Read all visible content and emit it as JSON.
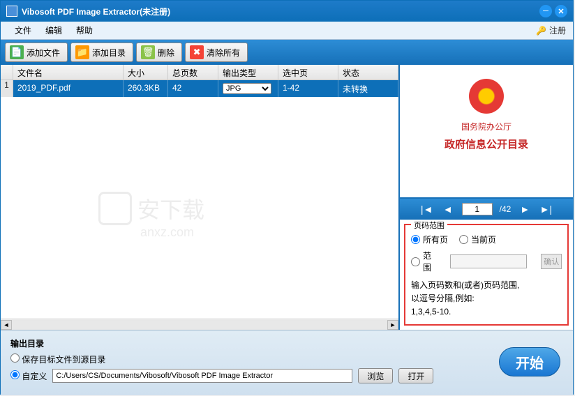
{
  "titlebar": {
    "title": "Vibosoft PDF Image Extractor(未注册)"
  },
  "menubar": {
    "file": "文件",
    "edit": "编辑",
    "help": "帮助",
    "register": "注册"
  },
  "toolbar": {
    "add_file": "添加文件",
    "add_folder": "添加目录",
    "delete": "删除",
    "clear_all": "清除所有"
  },
  "table": {
    "headers": {
      "name": "文件名",
      "size": "大小",
      "pages": "总页数",
      "type": "输出类型",
      "selected": "选中页",
      "status": "状态"
    },
    "rows": [
      {
        "idx": "1",
        "name": "2019_PDF.pdf",
        "size": "260.3KB",
        "pages": "42",
        "type": "JPG",
        "selected": "1-42",
        "status": "未转换"
      }
    ]
  },
  "watermark": {
    "text": "安下载",
    "sub": "anxz.com"
  },
  "preview": {
    "line1": "国务院办公厅",
    "line2": "政府信息公开目录"
  },
  "pager": {
    "current": "1",
    "total": "/42"
  },
  "range": {
    "legend": "页码范围",
    "all": "所有页",
    "current": "当前页",
    "custom": "范围",
    "ok": "确认",
    "help1": "输入页码数和(或者)页码范围,",
    "help2": "以逗号分隔,例如:",
    "help3": "1,3,4,5-10."
  },
  "output": {
    "label": "输出目录",
    "opt_source": "保存目标文件到源目录",
    "opt_custom": "自定义",
    "path": "C:/Users/CS/Documents/Vibosoft/Vibosoft PDF Image Extractor",
    "browse": "浏览",
    "open": "打开"
  },
  "start": "开始"
}
